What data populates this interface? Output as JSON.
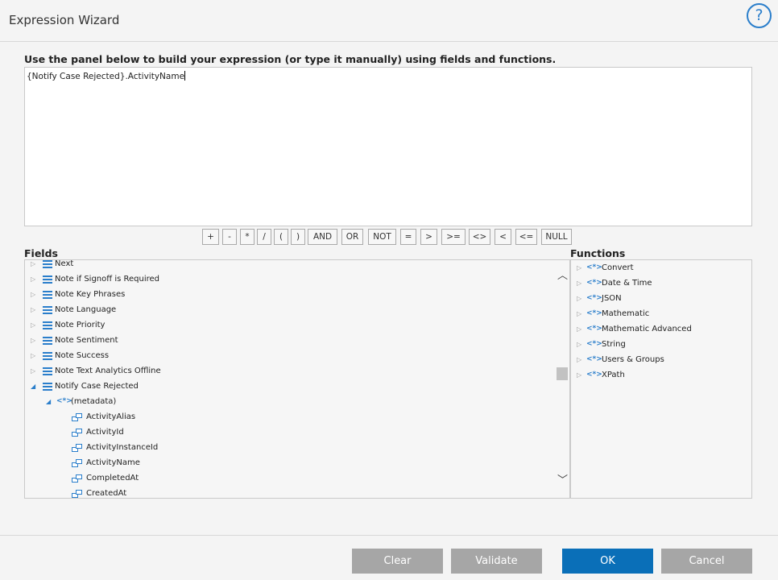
{
  "window": {
    "title": "Expression Wizard",
    "help_glyph": "?"
  },
  "instructions": "Use the panel below to build your expression (or type it manually) using fields and functions.",
  "expression": {
    "value": "{Notify Case Rejected}.ActivityName"
  },
  "operators": [
    "+",
    "-",
    "*",
    "/",
    "(",
    ")",
    "AND",
    "OR",
    "NOT",
    "=",
    ">",
    ">=",
    "<>",
    "<",
    "<=",
    "NULL"
  ],
  "fields": {
    "label": "Fields",
    "items": [
      {
        "label": "Next",
        "icon": "list-icon",
        "expanded": false
      },
      {
        "label": "Note if Signoff is Required",
        "icon": "list-icon",
        "expanded": false
      },
      {
        "label": "Note Key Phrases",
        "icon": "list-icon",
        "expanded": false
      },
      {
        "label": "Note Language",
        "icon": "list-icon",
        "expanded": false
      },
      {
        "label": "Note Priority",
        "icon": "list-icon",
        "expanded": false
      },
      {
        "label": "Note Sentiment",
        "icon": "list-icon",
        "expanded": false
      },
      {
        "label": "Note Success",
        "icon": "list-icon",
        "expanded": false
      },
      {
        "label": "Note Text Analytics Offline",
        "icon": "list-icon",
        "expanded": false
      },
      {
        "label": "Notify Case Rejected",
        "icon": "list-icon",
        "expanded": true
      },
      {
        "label": "(metadata)",
        "icon": "code-icon",
        "expanded": true
      },
      {
        "label": "ActivityAlias",
        "icon": "field-icon"
      },
      {
        "label": "ActivityId",
        "icon": "field-icon"
      },
      {
        "label": "ActivityInstanceId",
        "icon": "field-icon"
      },
      {
        "label": "ActivityName",
        "icon": "field-icon"
      },
      {
        "label": "CompletedAt",
        "icon": "field-icon"
      },
      {
        "label": "CreatedAt",
        "icon": "field-icon"
      }
    ]
  },
  "functions": {
    "label": "Functions",
    "items": [
      {
        "label": "Convert"
      },
      {
        "label": "Date & Time"
      },
      {
        "label": "JSON"
      },
      {
        "label": "Mathematic"
      },
      {
        "label": "Mathematic Advanced"
      },
      {
        "label": "String"
      },
      {
        "label": "Users & Groups"
      },
      {
        "label": "XPath"
      }
    ]
  },
  "footer": {
    "clear": "Clear",
    "validate": "Validate",
    "ok": "OK",
    "cancel": "Cancel"
  },
  "colors": {
    "accent": "#2a7ecb",
    "primary_button": "#0a6fb8",
    "secondary_button": "#a6a6a6"
  }
}
